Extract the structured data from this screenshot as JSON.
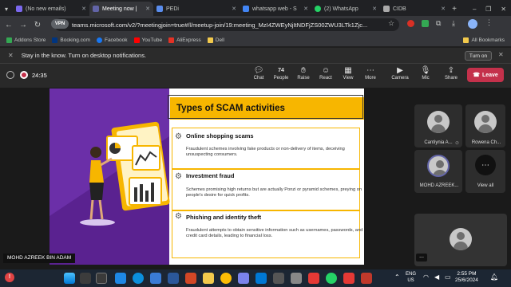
{
  "tabs": [
    {
      "label": "(No new emails)",
      "close": "✕"
    },
    {
      "label": "Meeting now |",
      "close": "✕"
    },
    {
      "label": "PEDi",
      "close": "✕"
    },
    {
      "label": "whatsapp web - S",
      "close": "✕"
    },
    {
      "label": "(2) WhatsApp",
      "close": "✕"
    },
    {
      "label": "CIDB",
      "close": "✕"
    }
  ],
  "nav": {
    "url": "teams.microsoft.com/v2/?meetingjoin=true#/l/meetup-join/19:meeting_MzI4ZWEyNjItNDFjZS00ZWU3LTk1Zjc...",
    "vpn": "VPN"
  },
  "bookmarks": {
    "items": [
      "Addons Store",
      "Booking.com",
      "Facebook",
      "YouTube",
      "AliExpress",
      "Dell"
    ],
    "all": "All Bookmarks"
  },
  "notification": {
    "text": "Stay in the know. Turn on desktop notifications.",
    "button": "Turn on"
  },
  "meeting": {
    "timer": "24:35",
    "toolbar": {
      "chat": "Chat",
      "people": "People",
      "people_count": "74",
      "raise": "Raise",
      "react": "React",
      "view": "View",
      "more": "More",
      "camera": "Camera",
      "mic": "Mic",
      "share": "Share",
      "leave": "Leave"
    }
  },
  "slide": {
    "title": "Types of SCAM activities",
    "items": [
      {
        "heading": "Online shopping scams",
        "body": "Fraudulent schemes involving fake products or non-delivery of items, deceiving unsuspecting consumers."
      },
      {
        "heading": "Investment fraud",
        "body": "Schemes promising high returns but are actually Ponzi or pyramid schemes, preying on people's desire for quick profits."
      },
      {
        "heading": "Phishing and identity theft",
        "body": "Fraudulent attempts to obtain sensitive information such as usernames, passwords, and credit card details, leading to financial loss."
      }
    ]
  },
  "participants": [
    {
      "name": "Cantiynia A..."
    },
    {
      "name": "Rowena Ch..."
    },
    {
      "name": "MOHD AZREEK..."
    },
    {
      "name": "View all"
    }
  ],
  "presenter_label": "MOHD AZREEK BIN ADAM",
  "more_dots": "...",
  "taskbar": {
    "lang_top": "ENG",
    "lang_bottom": "US",
    "time": "2:55 PM",
    "date": "25/6/2024"
  },
  "colors": {
    "accent_yellow": "#f7b600",
    "purple": "#6b2fa8",
    "leave_red": "#c4314b"
  }
}
